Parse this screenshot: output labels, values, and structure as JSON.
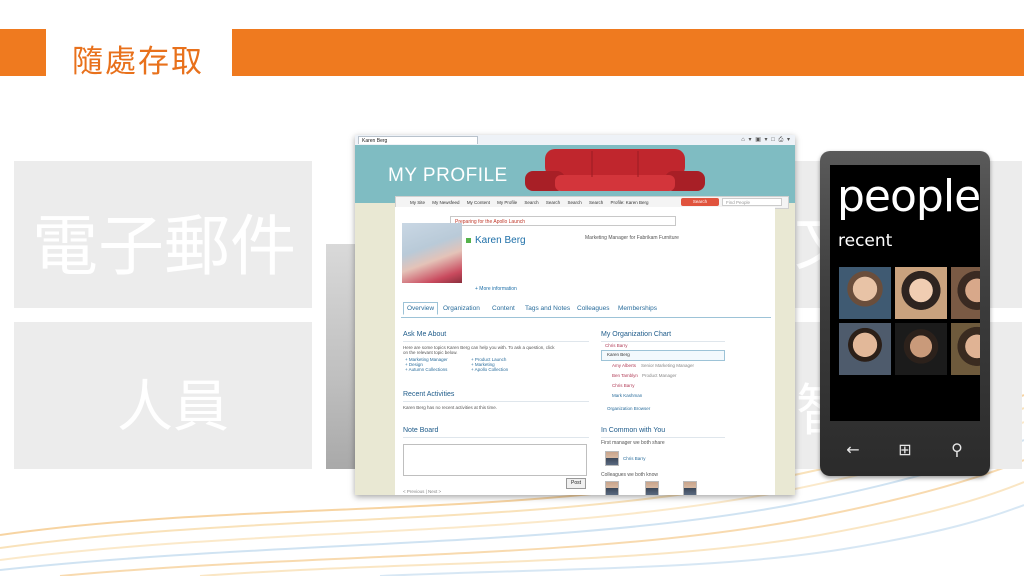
{
  "slide": {
    "title": "隨處存取",
    "tiles": {
      "email": "電子郵件",
      "people": "人員",
      "right_partial_top": "文",
      "right_partial_bottom": "智"
    }
  },
  "colors": {
    "accent": "#ef7a1f",
    "sharepoint_teal": "#7fbcc2",
    "link": "#1e6fa8"
  },
  "browser": {
    "tab_title": "Karen Berg",
    "tools": "⌂ ▾ ▣ ▾ □ ⎙ ▾"
  },
  "sharepoint": {
    "header_title": "MY PROFILE",
    "nav": [
      "My Site",
      "My Newsfeed",
      "My Content",
      "My Profile",
      "Search",
      "Search",
      "Search",
      "Search",
      "Profile: Karen Berg"
    ],
    "search_button": "Search",
    "search_placeholder": "Find People",
    "status_message": "Preparing for the Apollo Launch",
    "person_name": "Karen Berg",
    "job_title": "Marketing Manager for Fabrikam Furniture",
    "more_info": "+ More information",
    "tabs": [
      "Overview",
      "Organization",
      "Content",
      "Tags and Notes",
      "Colleagues",
      "Memberships"
    ],
    "ask_me_about": {
      "heading": "Ask Me About",
      "intro_1": "Here are some topics Karen Berg can help you with. To ask a question, click",
      "intro_2": "on the relevant topic below.",
      "col1": [
        "+ Marketing Manager",
        "+ Design",
        "+ Autumn Collections"
      ],
      "col2": [
        "+ Product Launch",
        "+ Marketing",
        "+ Apollo Collection"
      ]
    },
    "recent_activities": {
      "heading": "Recent Activities",
      "text": "Karen Berg has no recent activities at this time."
    },
    "note_board": {
      "heading": "Note Board",
      "post_button": "Post",
      "pager": "< Previous | Next >"
    },
    "org_chart": {
      "heading": "My Organization Chart",
      "manager": "Chris Barry",
      "self": "Karen Berg",
      "reports": [
        {
          "name": "Amy Alberts",
          "title": "Senior Marketing Manager"
        },
        {
          "name": "Ben Tamblyn",
          "title": "Product Manager"
        },
        {
          "name": "Chris Barry",
          "title": ""
        },
        {
          "name": "Mark Kashman",
          "title": ""
        }
      ],
      "browser_link": "Organization Browser"
    },
    "in_common": {
      "heading": "In Common with You",
      "manager_label": "First manager we both share",
      "manager_name": "Chris Barry",
      "colleagues_label": "Colleagues we both know"
    }
  },
  "phone": {
    "title": "people",
    "subtitle": "recent",
    "keys": {
      "back": "←",
      "start": "⊞",
      "search": "⚲"
    }
  }
}
